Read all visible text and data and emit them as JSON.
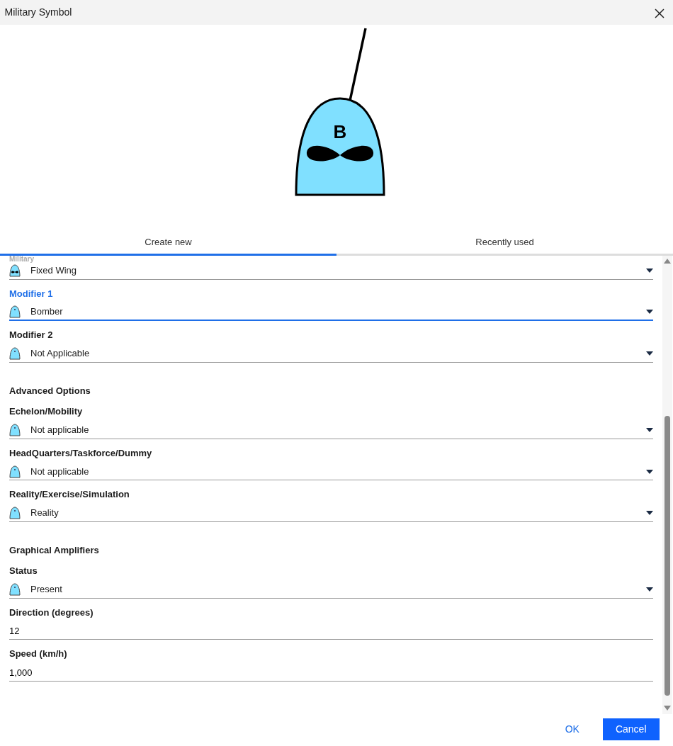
{
  "window": {
    "title": "Military Symbol"
  },
  "symbol": {
    "label": "B"
  },
  "tabs": [
    {
      "label": "Create new",
      "selected": true
    },
    {
      "label": "Recently used",
      "selected": false
    }
  ],
  "fields": [
    {
      "kind": "dropdown",
      "label": "Military",
      "value": "Fixed Wing",
      "focused": false
    },
    {
      "kind": "dropdown",
      "label": "Modifier 1",
      "value": "Bomber",
      "focused": true
    },
    {
      "kind": "dropdown",
      "label": "Modifier 2",
      "value": "Not Applicable",
      "focused": false
    },
    {
      "kind": "heading",
      "label": "Advanced Options"
    },
    {
      "kind": "dropdown",
      "label": "Echelon/Mobility",
      "value": "Not applicable",
      "focused": false
    },
    {
      "kind": "dropdown",
      "label": "HeadQuarters/Taskforce/Dummy",
      "value": "Not applicable",
      "focused": false
    },
    {
      "kind": "dropdown",
      "label": "Reality/Exercise/Simulation",
      "value": "Reality",
      "focused": false
    },
    {
      "kind": "heading",
      "label": "Graphical Amplifiers"
    },
    {
      "kind": "dropdown",
      "label": "Status",
      "value": "Present",
      "focused": false
    },
    {
      "kind": "text",
      "label": "Direction (degrees)",
      "value": "12",
      "focused": false
    },
    {
      "kind": "text",
      "label": "Speed (km/h)",
      "value": "1,000",
      "focused": false
    }
  ],
  "buttons": [
    {
      "label": "OK",
      "primary": false
    },
    {
      "label": "Cancel",
      "primary": true
    }
  ]
}
